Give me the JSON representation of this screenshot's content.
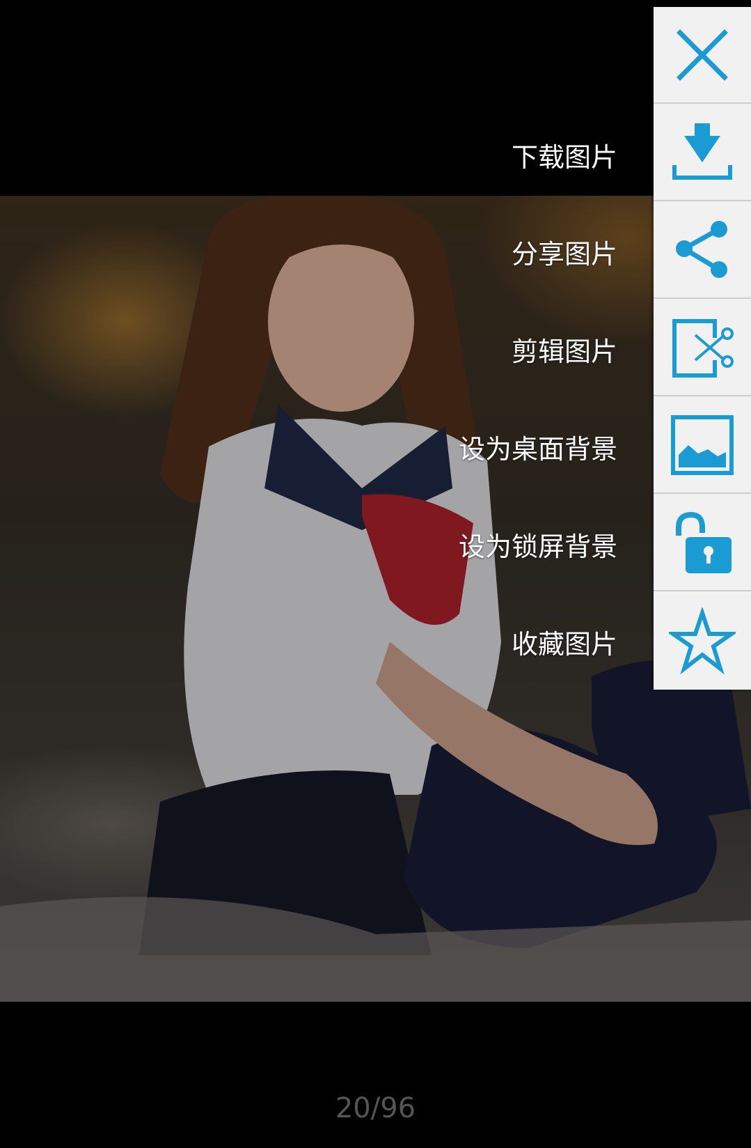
{
  "menu": {
    "items": [
      {
        "label": "下载图片",
        "icon": "download-icon"
      },
      {
        "label": "分享图片",
        "icon": "share-icon"
      },
      {
        "label": "剪辑图片",
        "icon": "crop-scissors-icon"
      },
      {
        "label": "设为桌面背景",
        "icon": "wallpaper-image-icon"
      },
      {
        "label": "设为锁屏背景",
        "icon": "unlock-icon"
      },
      {
        "label": "收藏图片",
        "icon": "star-icon"
      }
    ],
    "close_icon": "close-icon",
    "accent_color": "#1a9bd3"
  },
  "pager": {
    "counter": "20/96"
  }
}
